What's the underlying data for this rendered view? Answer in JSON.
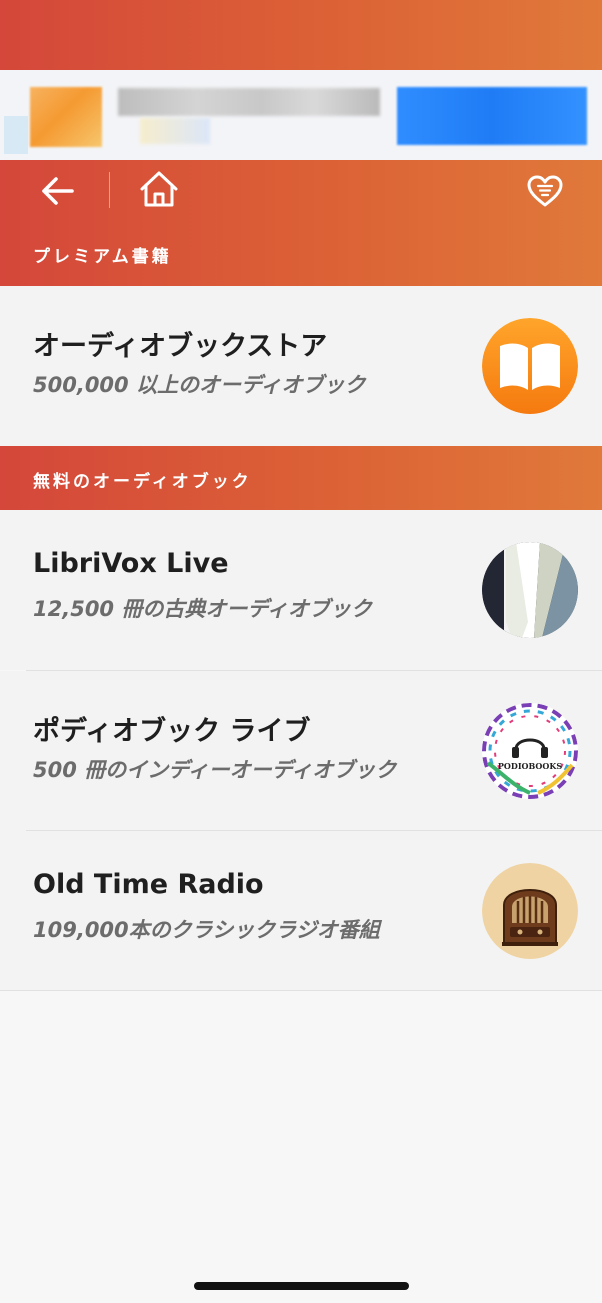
{
  "colors": {
    "accent_start": "#d4473a",
    "accent_end": "#e0793a",
    "row_background": "#f3f3f3",
    "title_text": "#1f1f1f",
    "subtitle_text": "#6c6c6c"
  },
  "nav": {
    "back_icon": "arrow-left-icon",
    "home_icon": "house-icon",
    "favorites_icon": "heart-list-icon"
  },
  "sections": {
    "premium_label": "プレミアム書籍",
    "free_label": "無料のオーディオブック"
  },
  "premium_items": [
    {
      "title": "オーディオブックストア",
      "subtitle": "500,000 以上のオーディオブック",
      "icon": "open-book-icon"
    }
  ],
  "free_items": [
    {
      "title": "LibriVox Live",
      "subtitle": "12,500 冊の古典オーディオブック",
      "icon": "librivox-logo-icon"
    },
    {
      "title": "ポディオブック ライブ",
      "subtitle": "500 冊のインディーオーディオブック",
      "icon": "podiobooks-logo-icon",
      "logo_text": "PODIOBOOKS"
    },
    {
      "title": "Old Time Radio",
      "subtitle": "109,000本のクラシックラジオ番組",
      "icon": "vintage-radio-icon"
    }
  ]
}
